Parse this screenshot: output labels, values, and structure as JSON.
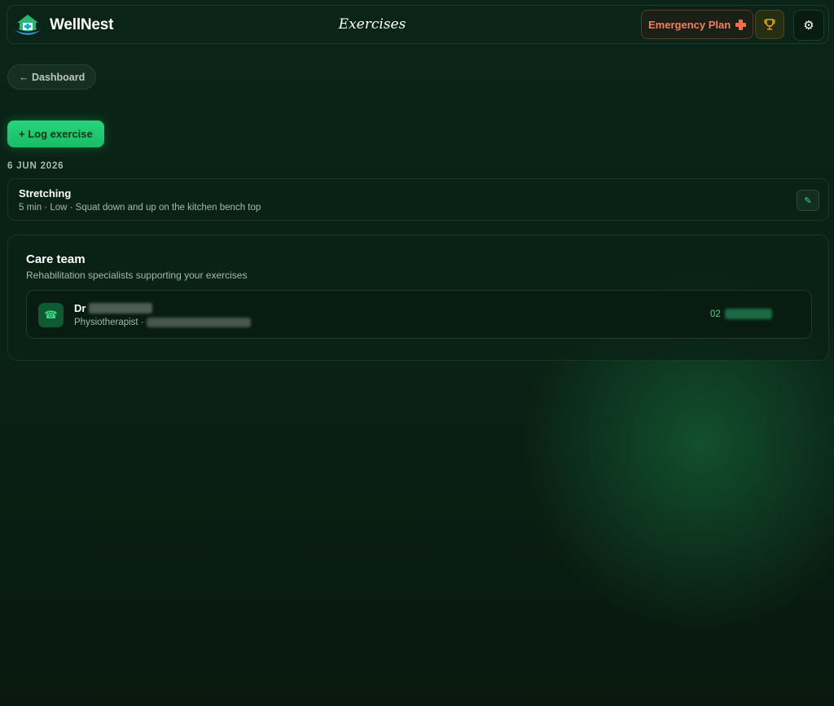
{
  "header": {
    "brand": "WellNest",
    "title": "Exercises",
    "emergency_label": "Emergency Plan",
    "trophy_icon": "trophy-icon",
    "settings_icon": "⚙"
  },
  "nav": {
    "back_label": "← Dashboard"
  },
  "actions": {
    "log_label": "+ Log exercise"
  },
  "log": {
    "date": "6 JUN 2026",
    "entries": [
      {
        "title": "Stretching",
        "meta": "5 min · Low · Squat down and up on the kitchen bench top",
        "edit_icon": "✎"
      }
    ]
  },
  "care_team": {
    "title": "Care team",
    "subtitle": "Rehabilitation specialists supporting your exercises",
    "contacts": [
      {
        "prefix": "Dr",
        "role": "Physiotherapist ·",
        "phone_prefix": "02",
        "icon": "☎"
      }
    ]
  },
  "colors": {
    "accent": "#22c96f",
    "emergency": "#ff7a5c",
    "trophy": "#e0a020"
  }
}
